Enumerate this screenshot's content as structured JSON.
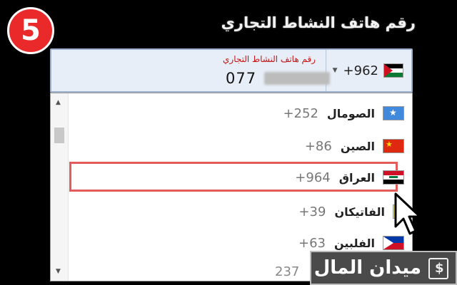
{
  "step_badge": "5",
  "heading": "رقم هاتف النشاط التجاري",
  "phone_field": {
    "label": "رقم هاتف النشاط التجاري",
    "value_visible": "077",
    "selected_code": "+962",
    "selected_flag": "jordan-flag-icon"
  },
  "countries": [
    {
      "name": "الصومال",
      "code": "+252",
      "flag": "somalia-flag-icon"
    },
    {
      "name": "الصين",
      "code": "+86",
      "flag": "china-flag-icon"
    },
    {
      "name": "العراق",
      "code": "+964",
      "flag": "iraq-flag-icon",
      "highlighted": true
    },
    {
      "name": "الفاتيكان",
      "code": "+39",
      "flag": "vatican-flag-icon"
    },
    {
      "name": "الفلبين",
      "code": "+63",
      "flag": "philippines-flag-icon"
    }
  ],
  "partial_next_code": "237",
  "watermark": {
    "text": "ميدان المال",
    "icon": "dollar-logo-icon"
  },
  "colors": {
    "badge": "#ea2a2a",
    "highlight": "#e45b5b",
    "label": "#c51515",
    "field_bg": "#e8eef8"
  }
}
